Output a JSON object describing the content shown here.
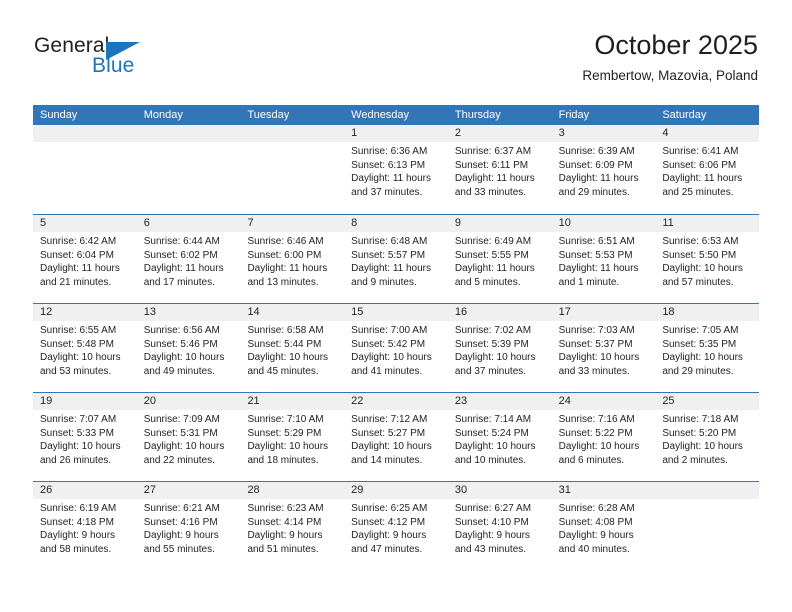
{
  "brand": {
    "name_part1": "General",
    "name_part2": "Blue",
    "accent_color": "#1c75bc"
  },
  "header": {
    "title": "October 2025",
    "location": "Rembertow, Mazovia, Poland"
  },
  "calendar": {
    "header_bg": "#3376b8",
    "daynum_bg": "#f0f0f0",
    "weekdays": [
      "Sunday",
      "Monday",
      "Tuesday",
      "Wednesday",
      "Thursday",
      "Friday",
      "Saturday"
    ],
    "weeks": [
      [
        {
          "day": "",
          "empty": true
        },
        {
          "day": "",
          "empty": true
        },
        {
          "day": "",
          "empty": true
        },
        {
          "day": "1",
          "sunrise": "Sunrise: 6:36 AM",
          "sunset": "Sunset: 6:13 PM",
          "daylight": "Daylight: 11 hours and 37 minutes."
        },
        {
          "day": "2",
          "sunrise": "Sunrise: 6:37 AM",
          "sunset": "Sunset: 6:11 PM",
          "daylight": "Daylight: 11 hours and 33 minutes."
        },
        {
          "day": "3",
          "sunrise": "Sunrise: 6:39 AM",
          "sunset": "Sunset: 6:09 PM",
          "daylight": "Daylight: 11 hours and 29 minutes."
        },
        {
          "day": "4",
          "sunrise": "Sunrise: 6:41 AM",
          "sunset": "Sunset: 6:06 PM",
          "daylight": "Daylight: 11 hours and 25 minutes."
        }
      ],
      [
        {
          "day": "5",
          "sunrise": "Sunrise: 6:42 AM",
          "sunset": "Sunset: 6:04 PM",
          "daylight": "Daylight: 11 hours and 21 minutes."
        },
        {
          "day": "6",
          "sunrise": "Sunrise: 6:44 AM",
          "sunset": "Sunset: 6:02 PM",
          "daylight": "Daylight: 11 hours and 17 minutes."
        },
        {
          "day": "7",
          "sunrise": "Sunrise: 6:46 AM",
          "sunset": "Sunset: 6:00 PM",
          "daylight": "Daylight: 11 hours and 13 minutes."
        },
        {
          "day": "8",
          "sunrise": "Sunrise: 6:48 AM",
          "sunset": "Sunset: 5:57 PM",
          "daylight": "Daylight: 11 hours and 9 minutes."
        },
        {
          "day": "9",
          "sunrise": "Sunrise: 6:49 AM",
          "sunset": "Sunset: 5:55 PM",
          "daylight": "Daylight: 11 hours and 5 minutes."
        },
        {
          "day": "10",
          "sunrise": "Sunrise: 6:51 AM",
          "sunset": "Sunset: 5:53 PM",
          "daylight": "Daylight: 11 hours and 1 minute."
        },
        {
          "day": "11",
          "sunrise": "Sunrise: 6:53 AM",
          "sunset": "Sunset: 5:50 PM",
          "daylight": "Daylight: 10 hours and 57 minutes."
        }
      ],
      [
        {
          "day": "12",
          "sunrise": "Sunrise: 6:55 AM",
          "sunset": "Sunset: 5:48 PM",
          "daylight": "Daylight: 10 hours and 53 minutes."
        },
        {
          "day": "13",
          "sunrise": "Sunrise: 6:56 AM",
          "sunset": "Sunset: 5:46 PM",
          "daylight": "Daylight: 10 hours and 49 minutes."
        },
        {
          "day": "14",
          "sunrise": "Sunrise: 6:58 AM",
          "sunset": "Sunset: 5:44 PM",
          "daylight": "Daylight: 10 hours and 45 minutes."
        },
        {
          "day": "15",
          "sunrise": "Sunrise: 7:00 AM",
          "sunset": "Sunset: 5:42 PM",
          "daylight": "Daylight: 10 hours and 41 minutes."
        },
        {
          "day": "16",
          "sunrise": "Sunrise: 7:02 AM",
          "sunset": "Sunset: 5:39 PM",
          "daylight": "Daylight: 10 hours and 37 minutes."
        },
        {
          "day": "17",
          "sunrise": "Sunrise: 7:03 AM",
          "sunset": "Sunset: 5:37 PM",
          "daylight": "Daylight: 10 hours and 33 minutes."
        },
        {
          "day": "18",
          "sunrise": "Sunrise: 7:05 AM",
          "sunset": "Sunset: 5:35 PM",
          "daylight": "Daylight: 10 hours and 29 minutes."
        }
      ],
      [
        {
          "day": "19",
          "sunrise": "Sunrise: 7:07 AM",
          "sunset": "Sunset: 5:33 PM",
          "daylight": "Daylight: 10 hours and 26 minutes."
        },
        {
          "day": "20",
          "sunrise": "Sunrise: 7:09 AM",
          "sunset": "Sunset: 5:31 PM",
          "daylight": "Daylight: 10 hours and 22 minutes."
        },
        {
          "day": "21",
          "sunrise": "Sunrise: 7:10 AM",
          "sunset": "Sunset: 5:29 PM",
          "daylight": "Daylight: 10 hours and 18 minutes."
        },
        {
          "day": "22",
          "sunrise": "Sunrise: 7:12 AM",
          "sunset": "Sunset: 5:27 PM",
          "daylight": "Daylight: 10 hours and 14 minutes."
        },
        {
          "day": "23",
          "sunrise": "Sunrise: 7:14 AM",
          "sunset": "Sunset: 5:24 PM",
          "daylight": "Daylight: 10 hours and 10 minutes."
        },
        {
          "day": "24",
          "sunrise": "Sunrise: 7:16 AM",
          "sunset": "Sunset: 5:22 PM",
          "daylight": "Daylight: 10 hours and 6 minutes."
        },
        {
          "day": "25",
          "sunrise": "Sunrise: 7:18 AM",
          "sunset": "Sunset: 5:20 PM",
          "daylight": "Daylight: 10 hours and 2 minutes."
        }
      ],
      [
        {
          "day": "26",
          "sunrise": "Sunrise: 6:19 AM",
          "sunset": "Sunset: 4:18 PM",
          "daylight": "Daylight: 9 hours and 58 minutes."
        },
        {
          "day": "27",
          "sunrise": "Sunrise: 6:21 AM",
          "sunset": "Sunset: 4:16 PM",
          "daylight": "Daylight: 9 hours and 55 minutes."
        },
        {
          "day": "28",
          "sunrise": "Sunrise: 6:23 AM",
          "sunset": "Sunset: 4:14 PM",
          "daylight": "Daylight: 9 hours and 51 minutes."
        },
        {
          "day": "29",
          "sunrise": "Sunrise: 6:25 AM",
          "sunset": "Sunset: 4:12 PM",
          "daylight": "Daylight: 9 hours and 47 minutes."
        },
        {
          "day": "30",
          "sunrise": "Sunrise: 6:27 AM",
          "sunset": "Sunset: 4:10 PM",
          "daylight": "Daylight: 9 hours and 43 minutes."
        },
        {
          "day": "31",
          "sunrise": "Sunrise: 6:28 AM",
          "sunset": "Sunset: 4:08 PM",
          "daylight": "Daylight: 9 hours and 40 minutes."
        },
        {
          "day": "",
          "empty": true
        }
      ]
    ]
  }
}
